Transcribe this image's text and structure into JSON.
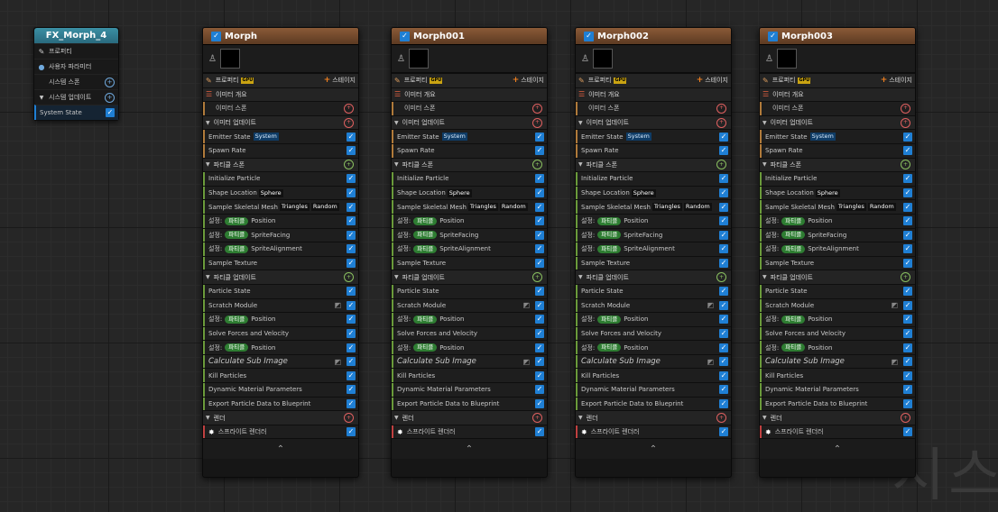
{
  "system": {
    "title": "FX_Morph_4",
    "properties": "프로퍼티",
    "user_params": "사용자 파라미터",
    "system_spawn": "시스템 스폰",
    "system_update": "시스템 업데이트",
    "system_state": "System State"
  },
  "labels": {
    "properties": "프로퍼티",
    "gpu": "GPU",
    "stage": "스테이지",
    "emitter_summary": "이미터 개요",
    "emitter_spawn": "이미터 스폰",
    "emitter_update": "이미터 업데이트",
    "emitter_state": "Emitter State",
    "system_tag": "System",
    "spawn_rate": "Spawn Rate",
    "particle_spawn": "파티클 스폰",
    "initialize_particle": "Initialize Particle",
    "shape_location": "Shape Location",
    "sphere": "Sphere",
    "sample_skeletal_mesh": "Sample Skeletal Mesh",
    "triangles": "Triangles",
    "random": "Random",
    "set": "설정:",
    "particle": "파티클",
    "position": "Position",
    "sprite_facing": "SpriteFacing",
    "sprite_alignment": "SpriteAlignment",
    "sample_texture": "Sample Texture",
    "particle_update": "파티클 업데이트",
    "particle_state": "Particle State",
    "scratch_module": "Scratch Module",
    "solve_forces": "Solve Forces and Velocity",
    "calc_sub_image": "Calculate Sub Image",
    "kill_particles": "Kill Particles",
    "dynamic_material": "Dynamic Material Parameters",
    "export_particle": "Export Particle Data to Blueprint",
    "render": "렌더",
    "sprite_renderer": "스프라이트 렌더러"
  },
  "emitters": [
    {
      "name": "Morph"
    },
    {
      "name": "Morph001"
    },
    {
      "name": "Morph002"
    },
    {
      "name": "Morph003"
    }
  ],
  "watermark": "시스",
  "colors": {
    "system_header": "#3b8fa4",
    "emitter_header": "#8a5a37",
    "checkbox": "#1f7fd4",
    "particle_pill": "#2e7d32"
  }
}
